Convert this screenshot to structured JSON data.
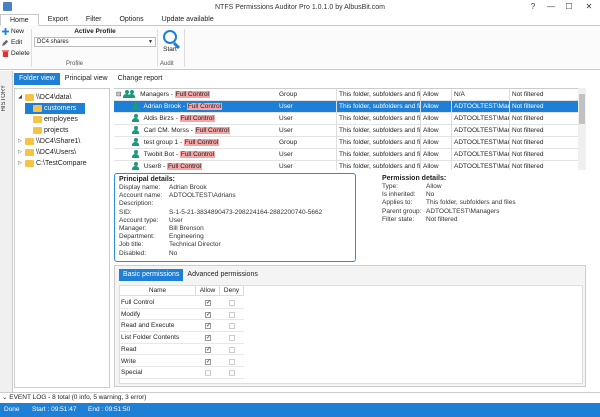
{
  "window": {
    "title": "NTFS Permissions Auditor Pro 1.0.1.0 by AlbusBit.com",
    "help": "?",
    "minimize": "—",
    "maximize": "☐",
    "close": "✕"
  },
  "menu": {
    "tabs": [
      "Home",
      "Export",
      "Filter",
      "Options",
      "Update available"
    ]
  },
  "ribbon": {
    "new_label": "New",
    "edit_label": "Edit",
    "delete_label": "Delete",
    "active_profile_label": "Active Profile",
    "profile_value": "DC4 shares",
    "profile_group": "Profile",
    "start_label": "Start",
    "audit_group": "Audit"
  },
  "sidebar": {
    "history_label": "HISTORY"
  },
  "view_tabs": [
    "Folder view",
    "Principal view",
    "Change report"
  ],
  "tree": [
    {
      "label": "\\\\DC4\\data\\",
      "arrow": "◢"
    },
    {
      "label": "customers",
      "arrow": ""
    },
    {
      "label": "employees",
      "arrow": ""
    },
    {
      "label": "projects",
      "arrow": ""
    },
    {
      "label": "\\\\DC4\\Share1\\",
      "arrow": "▷"
    },
    {
      "label": "\\\\DC4\\Users\\",
      "arrow": "▷"
    },
    {
      "label": "C:\\TestCompare",
      "arrow": "▷"
    }
  ],
  "permissions": [
    {
      "expander": "⊟",
      "name": "Managers - ",
      "fc": "Full Control",
      "type": "Group",
      "applies": "This folder, subfolders and files",
      "access": "Allow",
      "source": "N/A",
      "filter": "Not filtered"
    },
    {
      "expander": "",
      "name": "Adrian Brook - ",
      "fc": "Full Control",
      "type": "User",
      "applies": "This folder, subfolders and files",
      "access": "Allow",
      "source": "ADTOOLTEST\\Manage",
      "filter": "Not filtered"
    },
    {
      "expander": "",
      "name": "Aldis Birzs - ",
      "fc": "Full Control",
      "type": "User",
      "applies": "This folder, subfolders and files",
      "access": "Allow",
      "source": "ADTOOLTEST\\Manage",
      "filter": "Not filtered"
    },
    {
      "expander": "",
      "name": "Carl CM. Morss - ",
      "fc": "Full Control",
      "type": "User",
      "applies": "This folder, subfolders and files",
      "access": "Allow",
      "source": "ADTOOLTEST\\Manage",
      "filter": "Not filtered"
    },
    {
      "expander": "",
      "name": "test group 1 - ",
      "fc": "Full Control",
      "type": "Group",
      "applies": "This folder, subfolders and files",
      "access": "Allow",
      "source": "ADTOOLTEST\\Manage",
      "filter": "Not filtered"
    },
    {
      "expander": "",
      "name": "Twobit Bot - ",
      "fc": "Full Control",
      "type": "User",
      "applies": "This folder, subfolders and files",
      "access": "Allow",
      "source": "ADTOOLTEST\\Manage",
      "filter": "Not filtered"
    },
    {
      "expander": "",
      "name": "User8 - ",
      "fc": "Full Control",
      "type": "User",
      "applies": "This folder, subfolders and files",
      "access": "Allow",
      "source": "ADTOOLTEST\\Manage",
      "filter": "Not filtered"
    }
  ],
  "principal": {
    "title": "Principal details:",
    "rows": [
      {
        "k": "Display name:",
        "v": "Adrian Brook"
      },
      {
        "k": "Account name:",
        "v": "ADTOOLTEST\\Adrians"
      },
      {
        "k": "Description:",
        "v": ""
      },
      {
        "k": "SID:",
        "v": "S-1-5-21-3834890473-298224164-2882200740-5662"
      },
      {
        "k": "Account type:",
        "v": "User"
      },
      {
        "k": "Manager:",
        "v": "Bill Brenson"
      },
      {
        "k": "Department:",
        "v": "Engineering"
      },
      {
        "k": "Job title:",
        "v": "Technical Director"
      },
      {
        "k": "Disabled:",
        "v": "No"
      }
    ]
  },
  "permission_details": {
    "title": "Permission details:",
    "rows": [
      {
        "k": "Type:",
        "v": "Allow"
      },
      {
        "k": "Is inherited:",
        "v": "No"
      },
      {
        "k": "Applies to:",
        "v": "This folder, subfolders and files"
      },
      {
        "k": "Parent group:",
        "v": "ADTOOLTEST\\Managers"
      },
      {
        "k": "Filter state:",
        "v": "Not filtered"
      }
    ]
  },
  "subtabs": [
    "Basic permissions",
    "Advanced permissions"
  ],
  "rights_headers": {
    "name": "Name",
    "allow": "Allow",
    "deny": "Deny"
  },
  "rights": [
    {
      "name": "Full Control",
      "allow": "✓"
    },
    {
      "name": "Modify",
      "allow": "✓"
    },
    {
      "name": "Read and Execute",
      "allow": "✓"
    },
    {
      "name": "List Folder Contents",
      "allow": "✓"
    },
    {
      "name": "Read",
      "allow": "✓"
    },
    {
      "name": "Write",
      "allow": "✓"
    },
    {
      "name": "Special",
      "allow": ""
    }
  ],
  "status": {
    "event_log": "EVENT LOG - 8 total (0 info, 5 warning, 3 error)",
    "done": "Done",
    "start": "Start : 09:51:47",
    "end": "End : 09:51:50"
  }
}
